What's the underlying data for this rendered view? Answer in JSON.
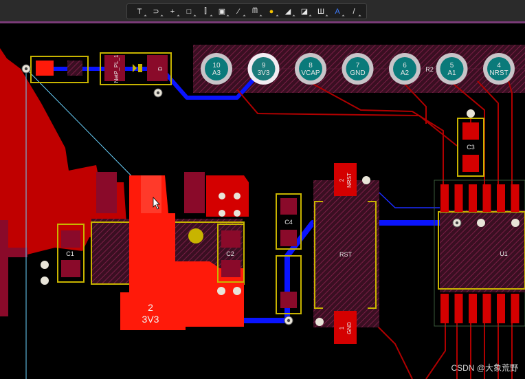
{
  "toolbar": {
    "tools": [
      {
        "name": "filter-tool",
        "glyph": "T"
      },
      {
        "name": "route-tool",
        "glyph": "⊃"
      },
      {
        "name": "crosshair-tool",
        "glyph": "+"
      },
      {
        "name": "select-rect-tool",
        "glyph": "□"
      },
      {
        "name": "align-tool",
        "glyph": "⫿"
      },
      {
        "name": "component-tool",
        "glyph": "▣"
      },
      {
        "name": "interactive-route-tool",
        "glyph": "⁄"
      },
      {
        "name": "diff-pair-tool",
        "glyph": "ᗰ"
      },
      {
        "name": "via-tool",
        "glyph": "●"
      },
      {
        "name": "polygon-tool",
        "glyph": "◢"
      },
      {
        "name": "keepout-tool",
        "glyph": "◪"
      },
      {
        "name": "dimension-tool",
        "glyph": "Ш"
      },
      {
        "name": "text-tool",
        "glyph": "A"
      },
      {
        "name": "line-tool",
        "glyph": "/"
      }
    ]
  },
  "header_pins": [
    {
      "num": "10",
      "net": "A3"
    },
    {
      "num": "9",
      "net": "3V3"
    },
    {
      "num": "8",
      "net": "VCAP"
    },
    {
      "num": "7",
      "net": "GND"
    },
    {
      "num": "6",
      "net": "A2"
    },
    {
      "num": "5",
      "net": "A1"
    },
    {
      "num": "4",
      "net": "NRST"
    }
  ],
  "designators": {
    "c1": "C1",
    "c2": "C2",
    "c3": "C3",
    "c4": "C4",
    "r2": "R2",
    "u1": "U1",
    "rst": "RST",
    "led_left": "NetP_PL_1",
    "led_right": "D",
    "nrst_pad_num": "2",
    "nrst_pad_net": "NRST",
    "gnd_pad_num": "1",
    "gnd_pad_net": "GND",
    "v3_pad_num": "2",
    "v3_pad_net": "3V3"
  },
  "watermark": "CSDN @大象荒野",
  "colors": {
    "top_copper": "#d40000",
    "top_copper_bright": "#ff2a1a",
    "bottom_copper": "#0a14ff",
    "overlay": "#c8b400",
    "pad_hatch": "#7a1e46",
    "header_pad": "#0a7a7a"
  }
}
